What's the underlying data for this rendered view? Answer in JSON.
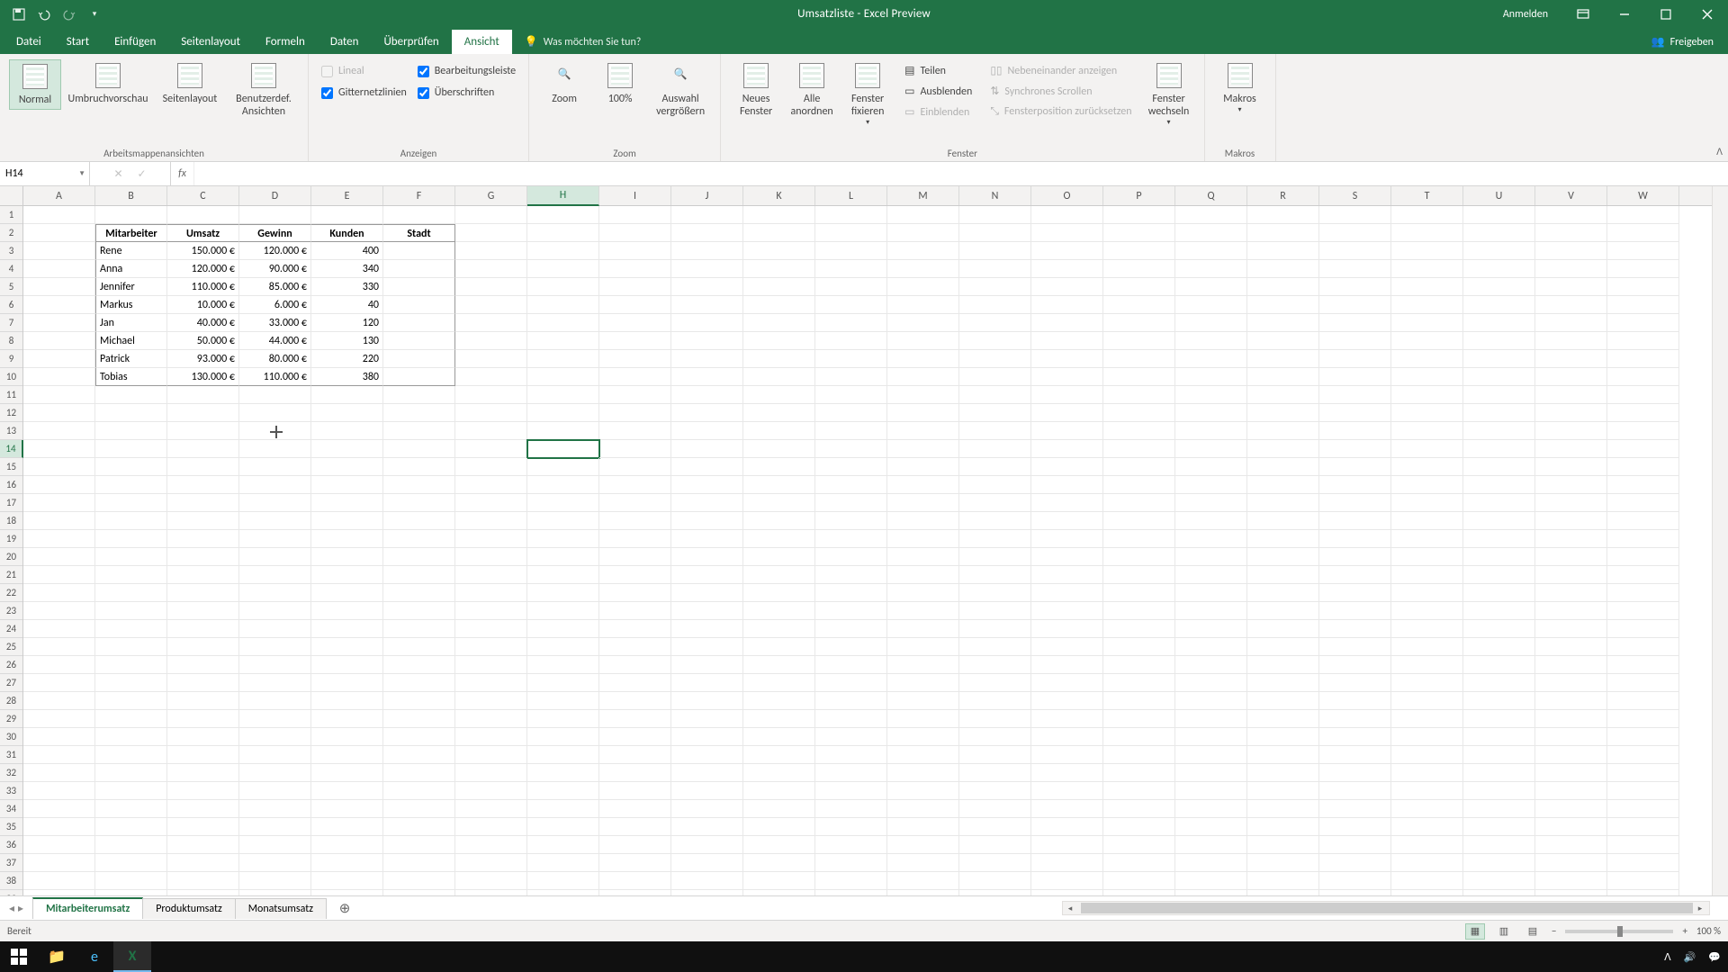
{
  "titlebar": {
    "title": "Umsatzliste  -  Excel Preview",
    "login": "Anmelden"
  },
  "menu": {
    "tabs": [
      "Datei",
      "Start",
      "Einfügen",
      "Seitenlayout",
      "Formeln",
      "Daten",
      "Überprüfen",
      "Ansicht"
    ],
    "active_index": 7,
    "tell_me": "Was möchten Sie tun?",
    "share": "Freigeben"
  },
  "ribbon": {
    "group_views": {
      "normal": "Normal",
      "umbruch": "Umbruchvorschau",
      "seitenlayout": "Seitenlayout",
      "benutzerdef": "Benutzerdef. Ansichten",
      "label": "Arbeitsmappenansichten"
    },
    "group_show": {
      "lineal": "Lineal",
      "bearbeitungsleiste": "Bearbeitungsleiste",
      "gitternetz": "Gitternetzlinien",
      "ueberschriften": "Überschriften",
      "label": "Anzeigen"
    },
    "group_zoom": {
      "zoom": "Zoom",
      "hundred": "100%",
      "auswahl": "Auswahl vergrößern",
      "label": "Zoom"
    },
    "group_window": {
      "neues": "Neues Fenster",
      "alle": "Alle anordnen",
      "fixieren": "Fenster fixieren",
      "teilen": "Teilen",
      "ausblenden": "Ausblenden",
      "einblenden": "Einblenden",
      "nebeneinander": "Nebeneinander anzeigen",
      "synchron": "Synchrones Scrollen",
      "fensterpos": "Fensterposition zurücksetzen",
      "wechseln": "Fenster wechseln",
      "label": "Fenster"
    },
    "group_macro": {
      "makros": "Makros",
      "label": "Makros"
    }
  },
  "namebox": "H14",
  "columns": [
    "A",
    "B",
    "C",
    "D",
    "E",
    "F",
    "G",
    "H",
    "I",
    "J",
    "K",
    "L",
    "M",
    "N",
    "O",
    "P",
    "Q",
    "R",
    "S",
    "T",
    "U",
    "V",
    "W"
  ],
  "selected_col": "H",
  "selected_row": 14,
  "table": {
    "headers": [
      "Mitarbeiter",
      "Umsatz",
      "Gewinn",
      "Kunden",
      "Stadt"
    ],
    "rows": [
      [
        "Rene",
        "150.000 €",
        "120.000 €",
        "400",
        ""
      ],
      [
        "Anna",
        "120.000 €",
        "90.000 €",
        "340",
        ""
      ],
      [
        "Jennifer",
        "110.000 €",
        "85.000 €",
        "330",
        ""
      ],
      [
        "Markus",
        "10.000 €",
        "6.000 €",
        "40",
        ""
      ],
      [
        "Jan",
        "40.000 €",
        "33.000 €",
        "120",
        ""
      ],
      [
        "Michael",
        "50.000 €",
        "44.000 €",
        "130",
        ""
      ],
      [
        "Patrick",
        "93.000 €",
        "80.000 €",
        "220",
        ""
      ],
      [
        "Tobias",
        "130.000 €",
        "110.000 €",
        "380",
        ""
      ]
    ]
  },
  "sheets": {
    "tabs": [
      "Mitarbeiterumsatz",
      "Produktumsatz",
      "Monatsumsatz"
    ],
    "active_index": 0
  },
  "statusbar": {
    "ready": "Bereit",
    "zoom": "100 %"
  }
}
